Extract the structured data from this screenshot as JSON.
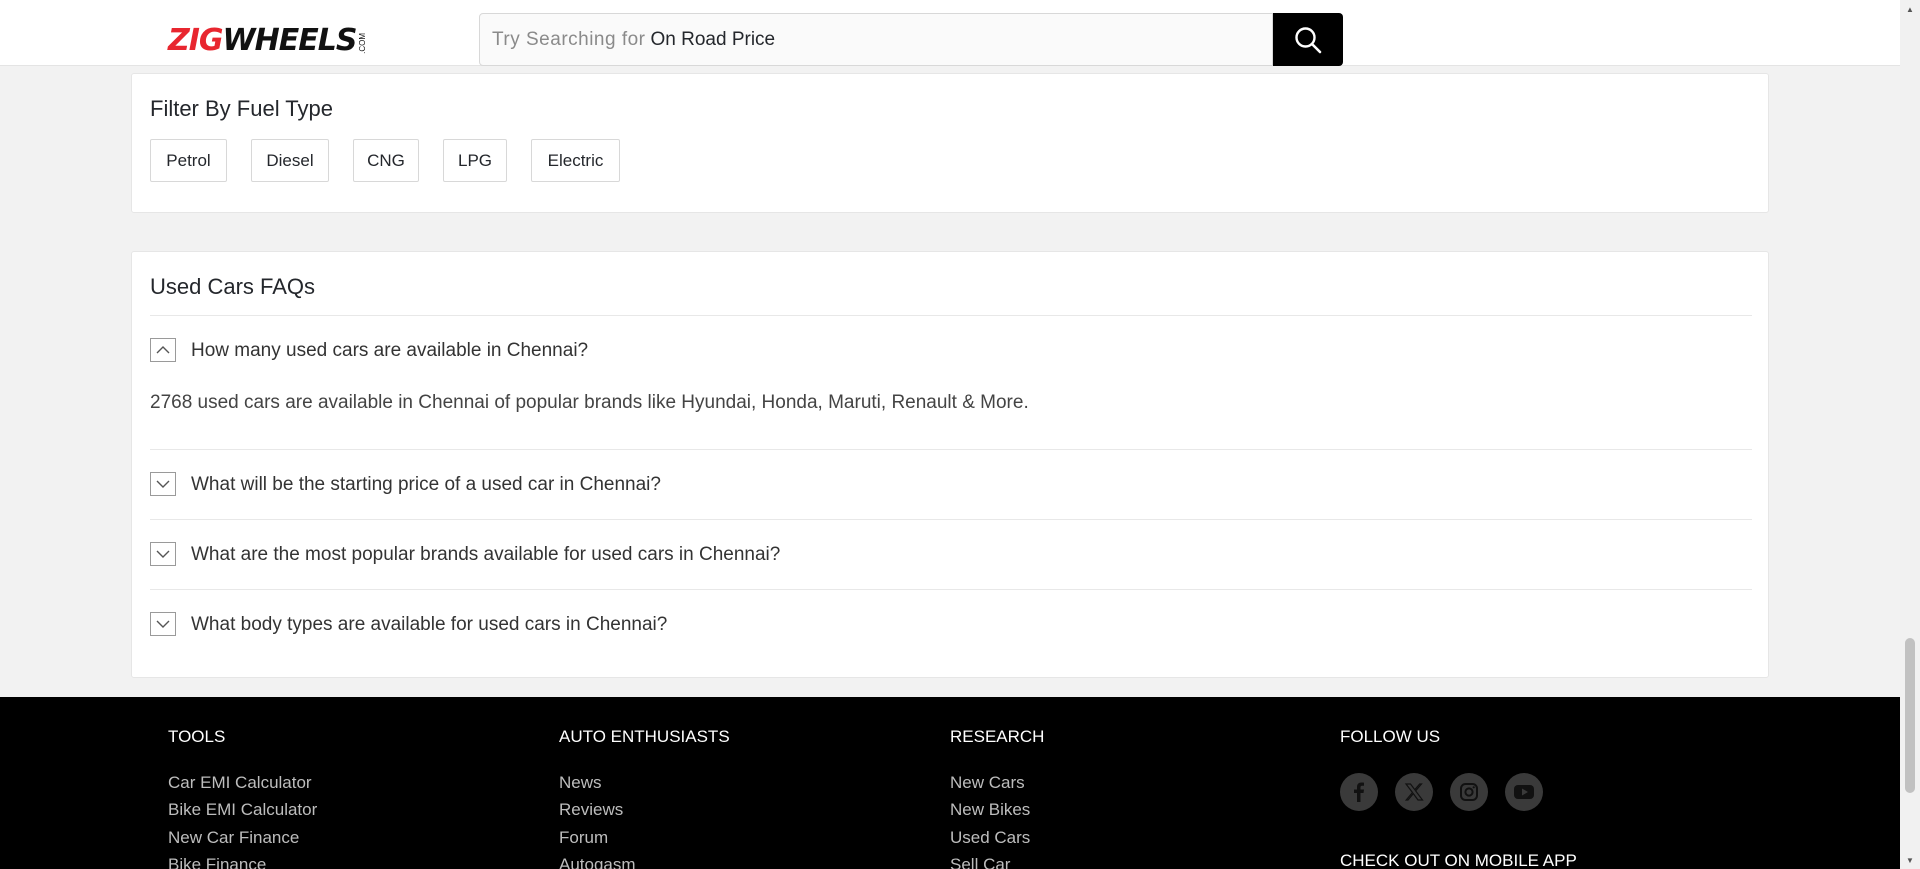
{
  "header": {
    "logo_primary": "ZIG",
    "logo_secondary": "WHEELS",
    "logo_suffix": ".COM",
    "search_hint": "Try Searching for",
    "search_value": "On Road Price",
    "search_icon": "search-icon"
  },
  "fuel_filter": {
    "title": "Filter By Fuel Type",
    "options": [
      "Petrol",
      "Diesel",
      "CNG",
      "LPG",
      "Electric"
    ]
  },
  "faq": {
    "title": "Used Cars FAQs",
    "items": [
      {
        "question": "How many used cars are available in Chennai?",
        "expanded": true,
        "answer": "2768 used cars are available in Chennai of popular brands like Hyundai, Honda, Maruti, Renault & More."
      },
      {
        "question": "What will be the starting price of a used car in Chennai?",
        "expanded": false
      },
      {
        "question": "What are the most popular brands available for used cars in Chennai?",
        "expanded": false
      },
      {
        "question": "What body types are available for used cars in Chennai?",
        "expanded": false
      }
    ]
  },
  "footer": {
    "tools": {
      "heading": "TOOLS",
      "links": [
        "Car EMI Calculator",
        "Bike EMI Calculator",
        "New Car Finance",
        "Bike Finance"
      ]
    },
    "auto_enthusiasts": {
      "heading": "AUTO ENTHUSIASTS",
      "links": [
        "News",
        "Reviews",
        "Forum",
        "Autogasm"
      ]
    },
    "research": {
      "heading": "RESEARCH",
      "links": [
        "New Cars",
        "New Bikes",
        "Used Cars",
        "Sell Car"
      ]
    },
    "follow_us": {
      "heading": "FOLLOW US",
      "icons": [
        "facebook-icon",
        "x-twitter-icon",
        "instagram-icon",
        "youtube-icon"
      ]
    },
    "mobile_app_heading": "CHECK OUT ON MOBILE APP"
  },
  "colors": {
    "brand_red": "#e8262f",
    "footer_bg": "#000000",
    "page_bg": "#f2f2f2"
  }
}
